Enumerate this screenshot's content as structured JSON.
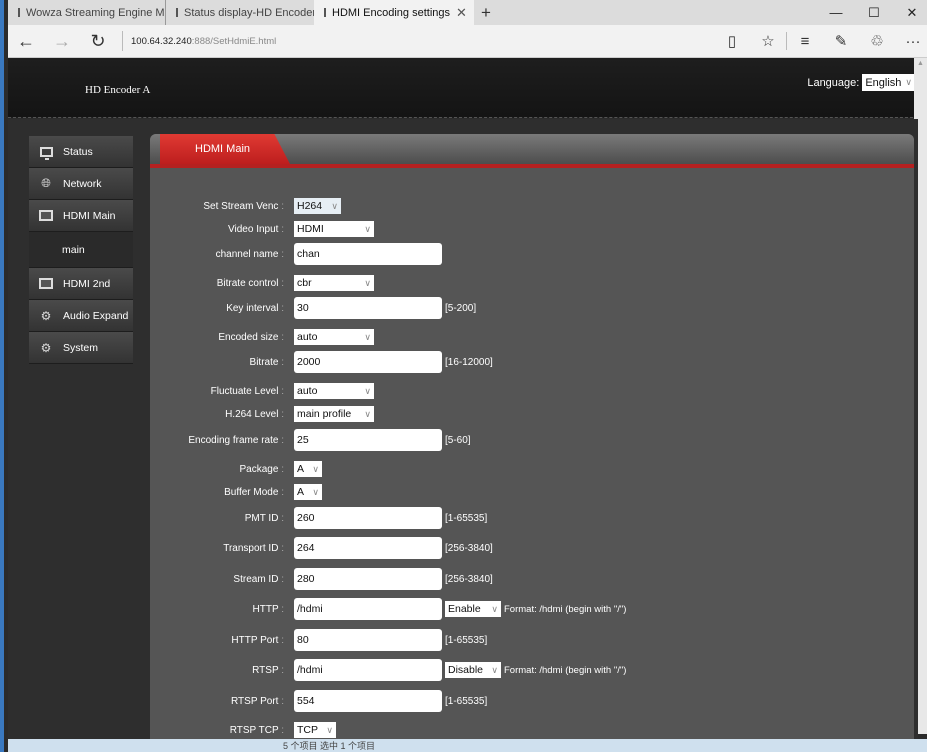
{
  "browser": {
    "tabs": [
      {
        "label": "Wowza Streaming Engine M",
        "active": false
      },
      {
        "label": "Status display-HD Encoder",
        "active": false
      },
      {
        "label": "HDMI Encoding settings",
        "active": true
      }
    ],
    "new_tab": "+",
    "close_tab": "✕",
    "window_controls": {
      "minimize": "—",
      "maximize": "☐",
      "close": "✕"
    },
    "url_host": "100.64.32.240",
    "url_rest": ":888/SetHdmiE.html",
    "nav": {
      "back": "←",
      "forward": "→",
      "refresh": "↻"
    },
    "toolbar_icons": {
      "reading_view": "▯",
      "favorite": "☆",
      "hub": "≡",
      "notes": "✎",
      "share": "♲",
      "more": "···"
    }
  },
  "header": {
    "brand": "HD Encoder  A",
    "language_label": "Language:",
    "language_value": "English"
  },
  "sidebar": {
    "items": [
      {
        "label": "Status",
        "icon": "monitor-icon"
      },
      {
        "label": "Network",
        "icon": "globe-icon"
      },
      {
        "label": "HDMI Main",
        "icon": "hdmi-icon"
      },
      {
        "label": "main",
        "icon": ""
      },
      {
        "label": "HDMI 2nd",
        "icon": "hdmi-icon"
      },
      {
        "label": "Audio Expand",
        "icon": "gear-dotted-icon"
      },
      {
        "label": "System",
        "icon": "gear-icon"
      }
    ]
  },
  "panel": {
    "tab_label": "HDMI Main",
    "fields": {
      "venc": {
        "label": "Set Stream Venc",
        "value": "H264"
      },
      "video_input": {
        "label": "Video Input",
        "value": "HDMI"
      },
      "channel_name": {
        "label": "channel name",
        "value": "chan"
      },
      "bitrate_control": {
        "label": "Bitrate control",
        "value": "cbr"
      },
      "key_interval": {
        "label": "Key interval",
        "value": "30",
        "hint": "[5-200]"
      },
      "encoded_size": {
        "label": "Encoded size",
        "value": "auto"
      },
      "bitrate": {
        "label": "Bitrate",
        "value": "2000",
        "hint": "[16-12000]"
      },
      "fluctuate_level": {
        "label": "Fluctuate Level",
        "value": "auto"
      },
      "h264_level": {
        "label": "H.264 Level",
        "value": "main profile"
      },
      "frame_rate": {
        "label": "Encoding frame rate",
        "value": "25",
        "hint": "[5-60]"
      },
      "package": {
        "label": "Package",
        "value": "A"
      },
      "buffer_mode": {
        "label": "Buffer Mode",
        "value": "A"
      },
      "pmt_id": {
        "label": "PMT ID",
        "value": "260",
        "hint": "[1-65535]"
      },
      "transport_id": {
        "label": "Transport ID",
        "value": "264",
        "hint": "[256-3840]"
      },
      "stream_id": {
        "label": "Stream ID",
        "value": "280",
        "hint": "[256-3840]"
      },
      "http": {
        "label": "HTTP",
        "value": "/hdmi",
        "mode": "Enable",
        "format": "Format: /hdmi (begin with \"/\")"
      },
      "http_port": {
        "label": "HTTP Port",
        "value": "80",
        "hint": "[1-65535]"
      },
      "rtsp": {
        "label": "RTSP",
        "value": "/hdmi",
        "mode": "Disable",
        "format": "Format: /hdmi (begin with \"/\")"
      },
      "rtsp_port": {
        "label": "RTSP Port",
        "value": "554",
        "hint": "[1-65535]"
      },
      "rtsp_tcp": {
        "label": "RTSP TCP",
        "value": "TCP"
      }
    }
  },
  "status_line": "5 个项目    选中 1 个项目"
}
